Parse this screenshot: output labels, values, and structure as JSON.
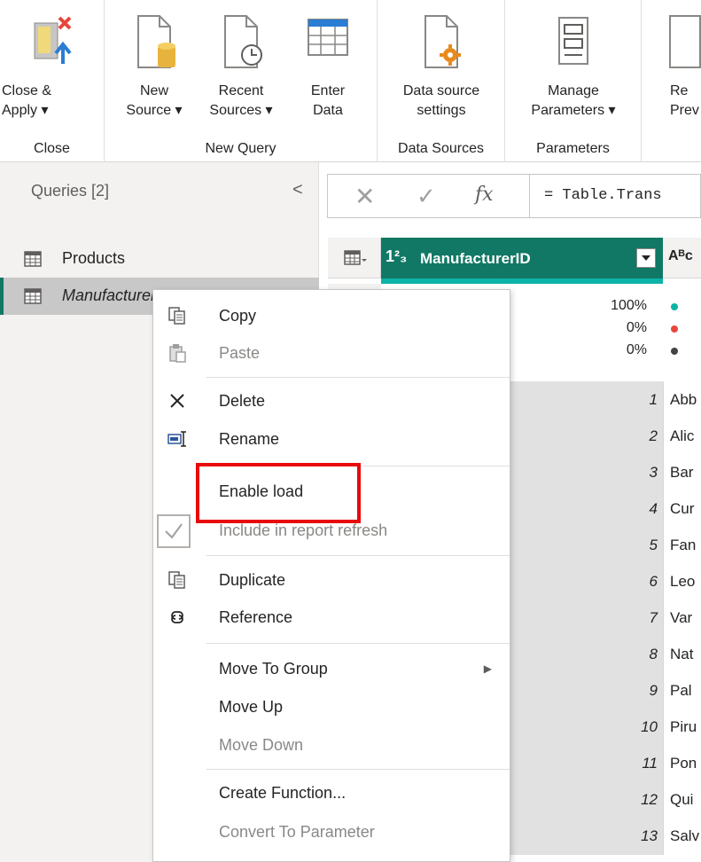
{
  "ribbon": {
    "groups": [
      {
        "label": "Close"
      },
      {
        "label": "New Query"
      },
      {
        "label": "Data Sources"
      },
      {
        "label": "Parameters"
      }
    ],
    "buttons": {
      "close_apply": [
        "Close &",
        "Apply ▾"
      ],
      "new_source": [
        "New",
        "Source ▾"
      ],
      "recent_sources": [
        "Recent",
        "Sources ▾"
      ],
      "enter_data": [
        "Enter",
        "Data"
      ],
      "data_source_settings": [
        "Data source",
        "settings"
      ],
      "manage_parameters": [
        "Manage",
        "Parameters ▾"
      ],
      "refresh_preview": [
        "Re",
        "Prev"
      ]
    }
  },
  "queries": {
    "header": "Queries [2]",
    "collapse_glyph": "<",
    "items": [
      {
        "name": "Products",
        "selected": false
      },
      {
        "name": "Manufacturers",
        "selected": true
      }
    ]
  },
  "formula_bar": {
    "cancel_glyph": "✕",
    "commit_glyph": "✓",
    "fx_glyph": "fx",
    "formula": "= Table.Trans"
  },
  "grid": {
    "column": {
      "type_label": "1²₃",
      "name": "ManufacturerID"
    },
    "column2": {
      "type_label": "Aᴮc"
    },
    "quality": [
      {
        "pct": "100%",
        "color": "#0cb3a7"
      },
      {
        "pct": "0%",
        "color": "#e8463c"
      },
      {
        "pct": "0%",
        "color": "#444444"
      }
    ],
    "rows": [
      {
        "id": "1",
        "name": "Abb"
      },
      {
        "id": "2",
        "name": "Alic"
      },
      {
        "id": "3",
        "name": "Bar"
      },
      {
        "id": "4",
        "name": "Cur"
      },
      {
        "id": "5",
        "name": "Fan"
      },
      {
        "id": "6",
        "name": "Leo"
      },
      {
        "id": "7",
        "name": "Var"
      },
      {
        "id": "8",
        "name": "Nat"
      },
      {
        "id": "9",
        "name": "Pal"
      },
      {
        "id": "10",
        "name": "Piru"
      },
      {
        "id": "11",
        "name": "Pon"
      },
      {
        "id": "12",
        "name": "Qui"
      },
      {
        "id": "13",
        "name": "Salv"
      }
    ]
  },
  "context_menu": {
    "items": {
      "copy": "Copy",
      "paste": "Paste",
      "delete": "Delete",
      "rename": "Rename",
      "enable_load": "Enable load",
      "include_refresh": "Include in report refresh",
      "duplicate": "Duplicate",
      "reference": "Reference",
      "move_to_group": "Move To Group",
      "move_up": "Move Up",
      "move_down": "Move Down",
      "create_function": "Create Function...",
      "convert_to_parameter": "Convert To Parameter"
    },
    "submenu_glyph": "▶",
    "include_refresh_checked": true
  },
  "colors": {
    "accent": "#117865",
    "highlight_box": "#e8090b",
    "quality_valid": "#0cb3a7"
  }
}
